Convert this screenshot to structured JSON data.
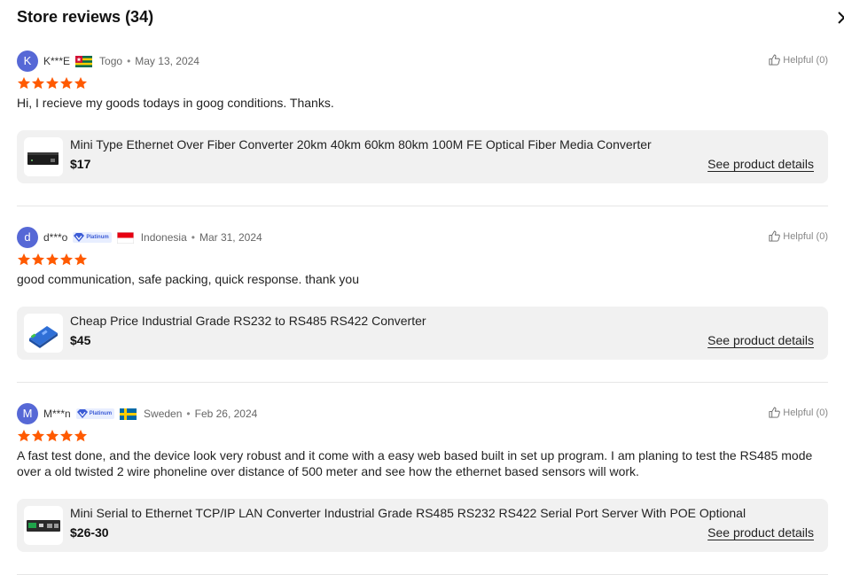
{
  "header": {
    "title": "Store reviews (34)"
  },
  "colors": {
    "accent_star": "#ff5a00",
    "avatar": "#5668d6",
    "badge": "#3b5bd6"
  },
  "reviews": [
    {
      "avatar_initial": "K",
      "reviewer": "K***E",
      "badge": "",
      "country": "Togo",
      "date": "May 13, 2024",
      "helpful": "Helpful (0)",
      "rating": 5,
      "text": "Hi, I recieve my goods todays in goog conditions. Thanks.",
      "product": {
        "name": "Mini Type Ethernet Over Fiber Converter 20km 40km 60km 80km 100M FE Optical Fiber Media Converter",
        "price": "$17",
        "details_label": "See product details"
      }
    },
    {
      "avatar_initial": "d",
      "reviewer": "d***o",
      "badge": "Platinum",
      "country": "Indonesia",
      "date": "Mar 31, 2024",
      "helpful": "Helpful (0)",
      "rating": 5,
      "text": "good communication, safe packing, quick response. thank you",
      "product": {
        "name": "Cheap Price Industrial Grade RS232 to RS485 RS422 Converter",
        "price": "$45",
        "details_label": "See product details"
      }
    },
    {
      "avatar_initial": "M",
      "reviewer": "M***n",
      "badge": "Platinum",
      "country": "Sweden",
      "date": "Feb 26, 2024",
      "helpful": "Helpful (0)",
      "rating": 5,
      "text": "A fast test done, and the device look very robust and it come with a easy web based built in set up program. I am planing to test the RS485 mode over a old twisted 2 wire phoneline over distance of 500 meter and see how the ethernet based sensors will work.",
      "product": {
        "name": "Mini Serial to Ethernet TCP/IP LAN Converter Industrial Grade RS485 RS232 RS422 Serial Port Server With POE Optional",
        "price": "$26-30",
        "details_label": "See product details"
      }
    }
  ]
}
